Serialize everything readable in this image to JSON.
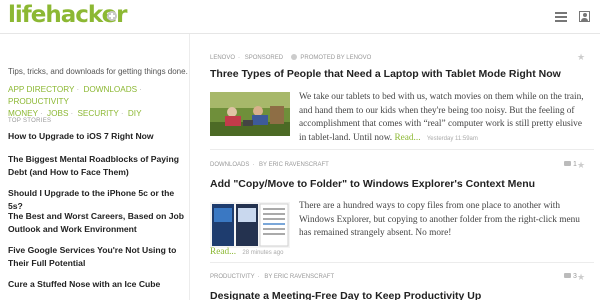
{
  "header": {
    "logo_text": "lifehacker",
    "logo_plus_icon": "plus-icon",
    "menu_icon": "hamburger-icon",
    "user_icon": "user-icon",
    "brand_color": "#8cb833"
  },
  "sidebar": {
    "tagline": "Tips, tricks, and downloads for getting things done.",
    "categories": [
      "APP DIRECTORY",
      "DOWNLOADS",
      "PRODUCTIVITY",
      "MONEY",
      "JOBS",
      "SECURITY",
      "DIY"
    ],
    "top_stories_label": "TOP STORIES",
    "top_stories": [
      "How to Upgrade to iOS 7 Right Now",
      "The Biggest Mental Roadblocks of Paying Debt (and How to Face Them)",
      "Should I Upgrade to the iPhone 5c or the 5s?",
      "The Best and Worst Careers, Based on Job Outlook and Work Environment",
      "Five Google Services You're Not Using to Their Full Potential",
      "Cure a Stuffed Nose with an Ice Cube"
    ]
  },
  "posts": [
    {
      "meta_category": "LENOVO",
      "meta_extra": "SPONSORED",
      "meta_promoted": "Promoted by LENOVO",
      "title": "Three Types of People that Need a Laptop with Tablet Mode Right Now",
      "excerpt": "We take our tablets to bed with us, watch movies on them while on the train, and hand them to our kids when they're being too noisy. But the feeling of accomplishment that comes with “real” computer work is still pretty elusive in tablet-land. Until now.",
      "read_more": "Read...",
      "time": "Yesterday 11:59am",
      "comments": ""
    },
    {
      "meta_category": "DOWNLOADS",
      "meta_author": "BY ERIC RAVENSCRAFT",
      "title": "Add \"Copy/Move to Folder\" to Windows Explorer's Context Menu",
      "excerpt": "There are a hundred ways to copy files from one place to another with Windows Explorer, but copying to another folder from the right-click menu has remained strangely absent. No more!",
      "read_more": "Read...",
      "time": "28 minutes ago",
      "comments": "1"
    },
    {
      "meta_category": "PRODUCTIVITY",
      "meta_author": "BY ERIC RAVENSCRAFT",
      "title": "Designate a Meeting-Free Day to Keep Productivity Up",
      "comments": "3"
    }
  ]
}
